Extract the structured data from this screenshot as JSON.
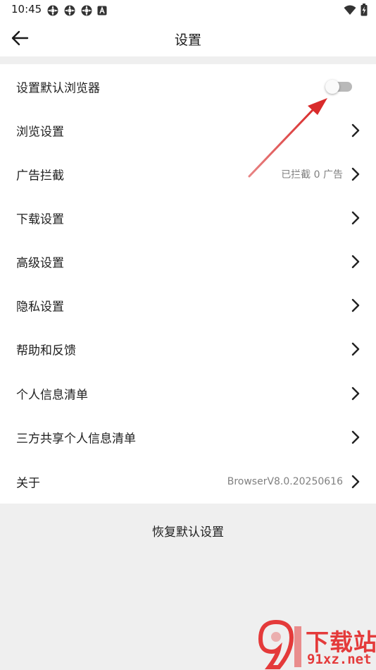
{
  "status_bar": {
    "time": "10:45",
    "icons": [
      "settings-gear-icon",
      "settings-gear-icon",
      "settings-gear-icon",
      "app-a-icon"
    ],
    "right_icons": [
      "wifi-icon",
      "battery-charging-icon"
    ]
  },
  "app_bar": {
    "back_icon": "arrow-left-icon",
    "title": "设置"
  },
  "settings": [
    {
      "label": "设置默认浏览器",
      "control": "toggle",
      "enabled": false
    },
    {
      "label": "浏览设置",
      "control": "chevron"
    },
    {
      "label": "广告拦截",
      "value": "已拦截 0 广告",
      "control": "chevron"
    },
    {
      "label": "下载设置",
      "control": "chevron"
    },
    {
      "label": "高级设置",
      "control": "chevron"
    },
    {
      "label": "隐私设置",
      "control": "chevron"
    },
    {
      "label": "帮助和反馈",
      "control": "chevron"
    },
    {
      "label": "个人信息清单",
      "control": "chevron"
    },
    {
      "label": "三方共享个人信息清单",
      "control": "chevron"
    },
    {
      "label": "关于",
      "value": "BrowserV8.0.20250616",
      "control": "chevron"
    }
  ],
  "restore": {
    "label": "恢复默认设置"
  },
  "annotation": {
    "type": "arrow",
    "color": "#d92b2b",
    "target": "default-browser-toggle"
  },
  "watermark": {
    "title": "下载站",
    "domain": "91xz.net",
    "color": "#e43a3a"
  },
  "colors": {
    "background": "#efefef",
    "surface": "#ffffff",
    "text_primary": "#1f1f1f",
    "text_secondary": "#808080",
    "toggle_track_off": "#b9b9b9"
  }
}
